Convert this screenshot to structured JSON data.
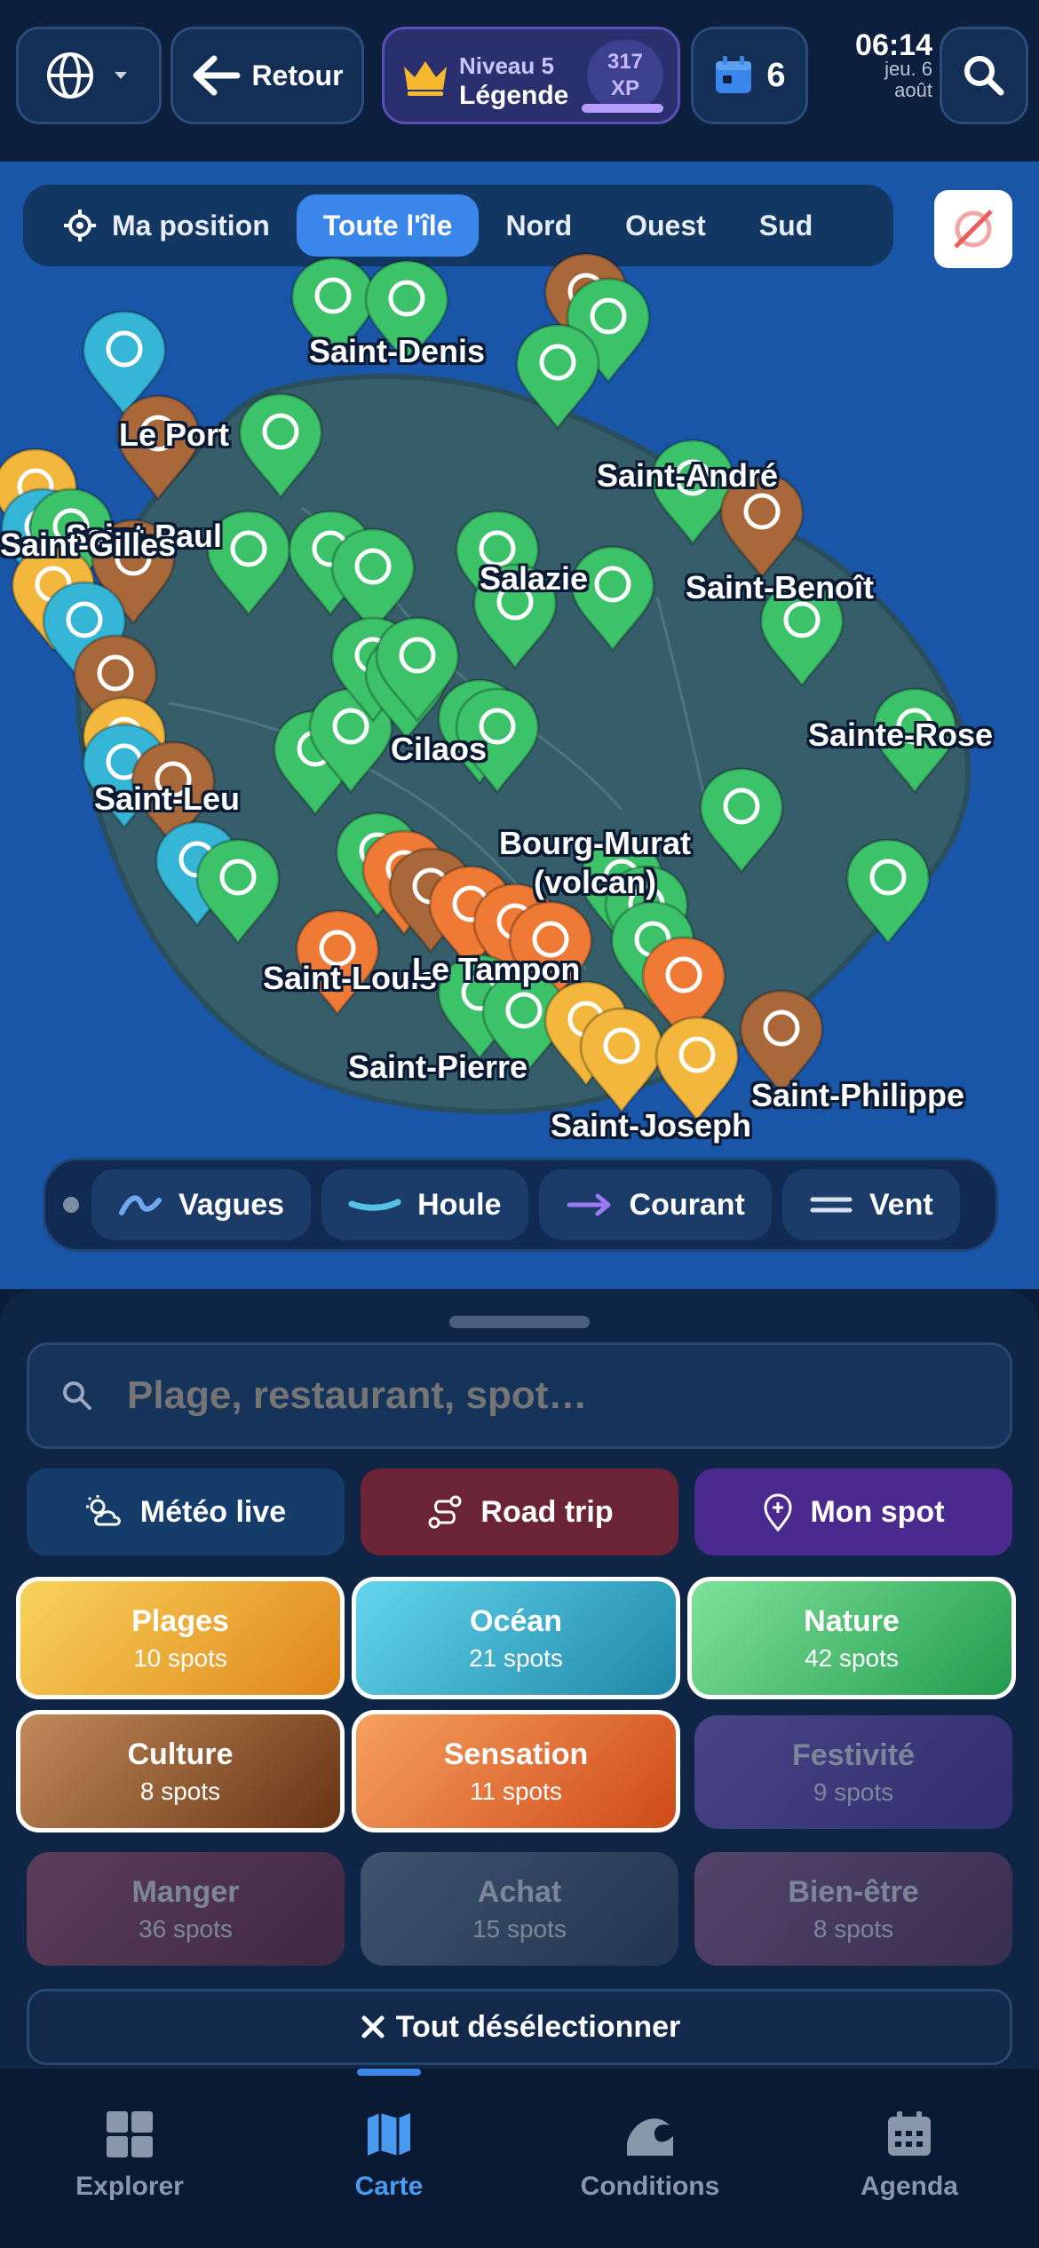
{
  "topbar": {
    "back_label": "Retour",
    "level_line1": "Niveau 5",
    "level_line2": "Légende",
    "xp_value": "317",
    "xp_unit": "XP",
    "agenda_count": "6",
    "time": "06:14",
    "date_line1": "jeu. 6",
    "date_line2": "août"
  },
  "map": {
    "filters": [
      {
        "label": "Ma position"
      },
      {
        "label": "Toute l'île"
      },
      {
        "label": "Nord"
      },
      {
        "label": "Ouest"
      },
      {
        "label": "Sud"
      }
    ],
    "active_filter": "Toute l'île",
    "cities": [
      "Saint-Denis",
      "Le Port",
      "Saint-Paul",
      "Saint-Gilles",
      "Saint-André",
      "Salazie",
      "Saint-Benoît",
      "Sainte-Rose",
      "Cilaos",
      "Saint-Leu",
      "Bourg-Murat (volcan)",
      "Saint-Louis",
      "Le Tampon",
      "Saint-Pierre",
      "Saint-Joseph",
      "Saint-Philippe"
    ],
    "layers": [
      "Vagues",
      "Houle",
      "Courant",
      "Vent"
    ]
  },
  "sheet": {
    "search_placeholder": "Plage, restaurant, spot…",
    "actions": [
      "Météo live",
      "Road trip",
      "Mon spot"
    ],
    "categories": [
      {
        "name": "Plages",
        "count": "10 spots"
      },
      {
        "name": "Océan",
        "count": "21 spots"
      },
      {
        "name": "Nature",
        "count": "42 spots"
      },
      {
        "name": "Culture",
        "count": "8 spots"
      },
      {
        "name": "Sensation",
        "count": "11 spots"
      },
      {
        "name": "Festivité",
        "count": "9 spots"
      },
      {
        "name": "Manger",
        "count": "36 spots"
      },
      {
        "name": "Achat",
        "count": "15 spots"
      },
      {
        "name": "Bien-être",
        "count": "8 spots"
      }
    ],
    "deselect_label": "Tout désélectionner"
  },
  "nav": [
    "Explorer",
    "Carte",
    "Conditions",
    "Agenda"
  ],
  "colors": {
    "accent": "#3b86ea",
    "plages": "#f2b73c",
    "ocean": "#35b6d6",
    "nature": "#3cc36a",
    "culture": "#a9683a",
    "sensation": "#ee7a36",
    "festivite": "#5b3c8f",
    "manger": "#7a2e44",
    "achat": "#3a4a5e",
    "bienetre": "#6a3a5e"
  }
}
